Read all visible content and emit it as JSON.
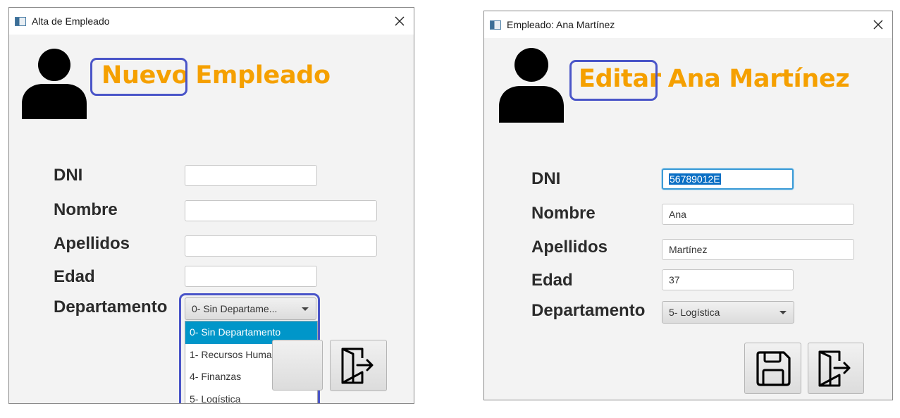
{
  "new_window": {
    "title": "Alta de Empleado",
    "heading_word1": "Nuevo",
    "heading_word2": "Empleado",
    "labels": {
      "dni": "DNI",
      "nombre": "Nombre",
      "apellidos": "Apellidos",
      "edad": "Edad",
      "departamento": "Departamento"
    },
    "values": {
      "dni": "",
      "nombre": "",
      "apellidos": "",
      "edad": ""
    },
    "department_selected": "0- Sin Departame...",
    "department_options": [
      "0- Sin Departamento",
      "1- Recursos Humanos",
      "4- Finanzas",
      "5- Logística"
    ]
  },
  "edit_window": {
    "title": "Empleado: Ana Martínez",
    "heading_word1": "Editar",
    "heading_word2": "Ana Martínez",
    "labels": {
      "dni": "DNI",
      "nombre": "Nombre",
      "apellidos": "Apellidos",
      "edad": "Edad",
      "departamento": "Departamento"
    },
    "values": {
      "dni": "56789012E",
      "nombre": "Ana",
      "apellidos": "Martínez",
      "edad": "37"
    },
    "department_selected": "5- Logística"
  },
  "icons": {
    "avatar": "user-silhouette-icon",
    "close": "close-icon",
    "save": "floppy-disk-icon",
    "exit": "exit-door-icon"
  },
  "colors": {
    "heading": "#f5a000",
    "highlight_outline": "#4a55c8",
    "selected_option": "#0096c9",
    "focus_border": "#3c9bd6"
  }
}
